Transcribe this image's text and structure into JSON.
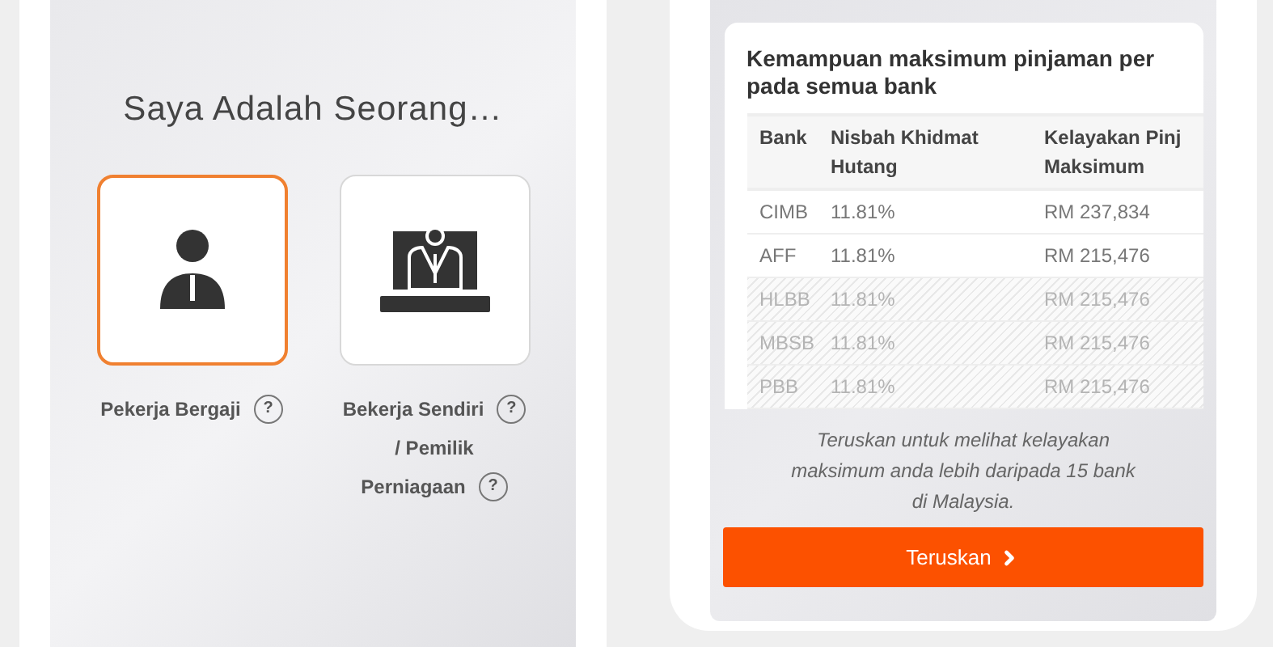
{
  "left_screen": {
    "title": "Saya Adalah Seorang…",
    "options": [
      {
        "kind": "employee",
        "label_lines": [
          "Pekerja Bergaji"
        ],
        "selected": true
      },
      {
        "kind": "business",
        "label_lines": [
          "Bekerja Sendiri",
          "/ Pemilik",
          "Perniagaan"
        ],
        "selected": false
      }
    ],
    "help_mark": "?"
  },
  "right_screen": {
    "card_title_lines": [
      "Kemampuan maksimum pinjaman per",
      "pada semua bank"
    ],
    "table": {
      "columns": [
        "Bank",
        "Nisbah Khidmat Hutang",
        "Kelayakan Pinj Maksimum"
      ],
      "rows": [
        {
          "cells": [
            "CIMB",
            "11.81%",
            "RM 237,834"
          ],
          "faded": false
        },
        {
          "cells": [
            "AFF",
            "11.81%",
            "RM 215,476"
          ],
          "faded": false
        },
        {
          "cells": [
            "HLBB",
            "11.81%",
            "RM 215,476"
          ],
          "faded": true
        },
        {
          "cells": [
            "MBSB",
            "11.81%",
            "RM 215,476"
          ],
          "faded": true
        },
        {
          "cells": [
            "PBB",
            "11.81%",
            "RM 215,476"
          ],
          "faded": true
        }
      ]
    },
    "note": "Teruskan untuk melihat kelayakan maksimum anda lebih daripada 15 bank di Malaysia.",
    "button": "Teruskan"
  }
}
